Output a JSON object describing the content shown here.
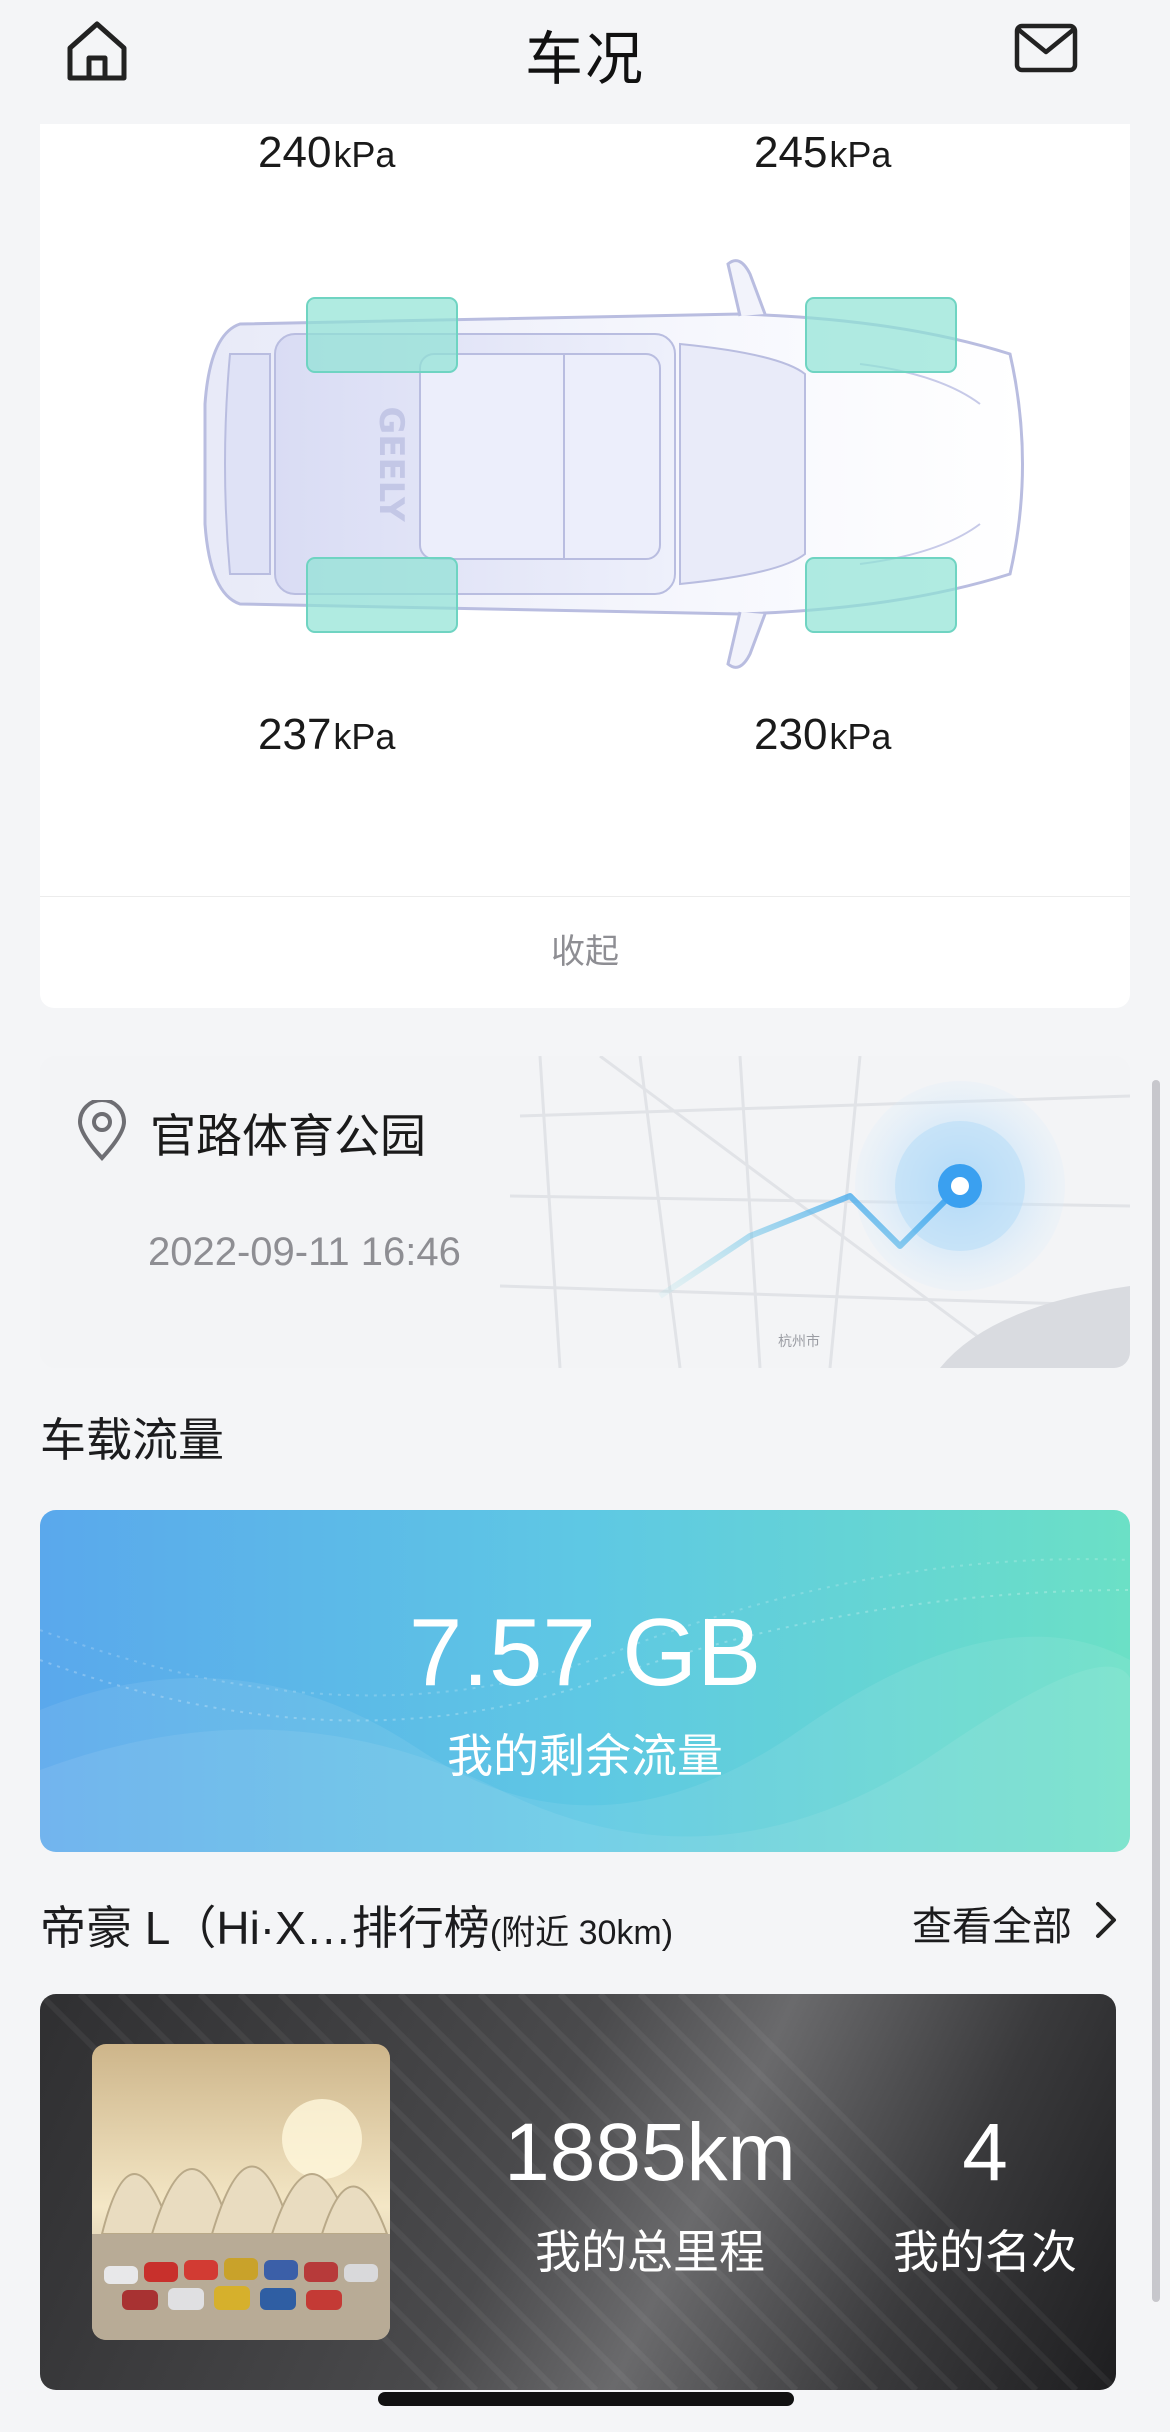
{
  "header": {
    "title": "车况"
  },
  "tires": {
    "unit": "kPa",
    "front_left": "240",
    "front_right": "245",
    "rear_left": "237",
    "rear_right": "230",
    "collapse_label": "收起",
    "car_logo_text": "GEELY"
  },
  "location": {
    "name": "官路体育公园",
    "time": "2022-09-11 16:46",
    "map_labels": [
      "杭州市"
    ]
  },
  "data_plan": {
    "section_title": "车载流量",
    "value": "7.57 GB",
    "label": "我的剩余流量"
  },
  "ranking": {
    "title": "帝豪 L（Hi·X…排行榜",
    "subtitle": "(附近 30km)",
    "see_all": "查看全部",
    "mileage_value": "1885km",
    "mileage_label": "我的总里程",
    "rank_value": "4",
    "rank_label": "我的名次"
  },
  "colors": {
    "tire_highlight": "#8fe3d4",
    "location_accent": "#3aa0f0",
    "data_gradient_start": "#5aa8ec",
    "data_gradient_end": "#6be0c6"
  },
  "icons": [
    "home-icon",
    "mail-icon",
    "location-pin-icon",
    "chevron-right-icon"
  ]
}
